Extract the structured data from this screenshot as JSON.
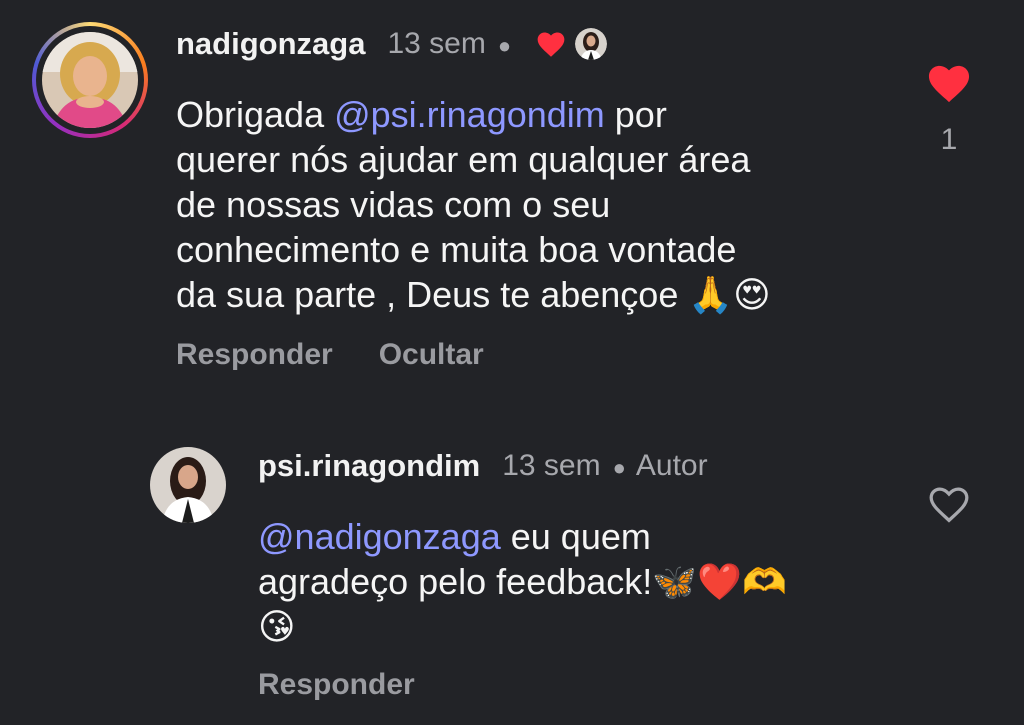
{
  "comments": [
    {
      "username": "nadigonzaga",
      "time": "13 sem",
      "text_prefix": "Obrigada ",
      "mention": "psi.rinagondim",
      "text_lines": [
        " por",
        "querer nós ajudar em qualquer área",
        "de nossas vidas com o seu",
        "conhecimento e muita boa vontade",
        "da sua parte , Deus te abençoe 🙏😍"
      ],
      "actions": [
        "Responder",
        "Ocultar"
      ],
      "like_count": "1",
      "liked": true,
      "heart_icon": "heart-filled-icon"
    },
    {
      "username": "psi.rinagondim",
      "time": "13 sem",
      "badge": "Autor",
      "mention": "nadigonzaga",
      "text_lines": [
        " eu quem",
        "agradeço pelo feedback!🦋❤️🫶",
        "😘"
      ],
      "actions": [
        "Responder"
      ],
      "liked": false,
      "heart_icon": "heart-outline-icon"
    }
  ],
  "colors": {
    "background": "#222327",
    "mention": "#8e98ff",
    "secondary_text": "#a7a8ad",
    "like_red": "#ff3040"
  }
}
